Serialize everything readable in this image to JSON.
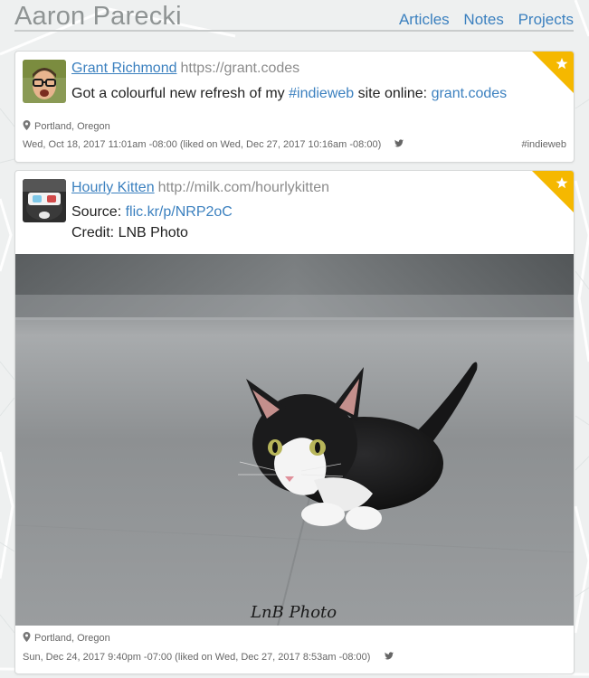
{
  "header": {
    "site_title": "Aaron Parecki",
    "nav": [
      "Articles",
      "Notes",
      "Projects"
    ]
  },
  "posts": [
    {
      "author_name": "Grant Richmond",
      "author_url": "https://grant.codes",
      "content_prefix": "Got a colourful new refresh of my ",
      "content_tag": "#indieweb",
      "content_middle": " site online: ",
      "content_link": "grant.codes",
      "location": "Portland, Oregon",
      "date_line": "Wed, Oct 18, 2017 11:01am -08:00 (liked on Wed, Dec 27, 2017 10:16am -08:00)",
      "tag": "#indieweb"
    },
    {
      "author_name": "Hourly Kitten",
      "author_url": "http://milk.com/hourlykitten",
      "source_label": "Source: ",
      "source_link": "flic.kr/p/NRP2oC",
      "credit": "Credit: LNB Photo",
      "photo_signature": "LnB Photo",
      "location": "Portland, Oregon",
      "date_line": "Sun, Dec 24, 2017 9:40pm -07:00 (liked on Wed, Dec 27, 2017 8:53am -08:00)"
    }
  ],
  "colors": {
    "link": "#3b80bf",
    "badge": "#f5b800"
  },
  "icons": [
    "star-icon",
    "map-pin-icon",
    "twitter-icon"
  ]
}
